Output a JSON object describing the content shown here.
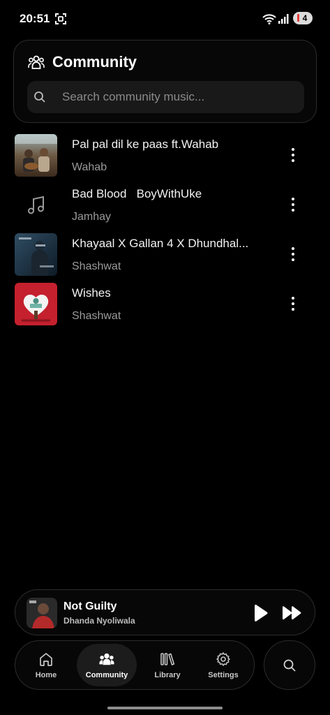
{
  "status_bar": {
    "time": "20:51",
    "battery": "4"
  },
  "header": {
    "title": "Community",
    "icon": "community-icon"
  },
  "search": {
    "placeholder": "Search community music..."
  },
  "songs": [
    {
      "title": "Pal pal dil ke paas ft.Wahab",
      "artist": "Wahab"
    },
    {
      "title": "Bad Blood   BoyWithUke",
      "artist": "Jamhay"
    },
    {
      "title": "Khayaal X Gallan 4 X Dhundhal...",
      "artist": "Shashwat"
    },
    {
      "title": "Wishes",
      "artist": "Shashwat"
    }
  ],
  "now_playing": {
    "title": "Not Guilty",
    "artist": "Dhanda Nyoliwala"
  },
  "nav": {
    "home": "Home",
    "community": "Community",
    "library": "Library",
    "settings": "Settings",
    "active": "community"
  },
  "colors": {
    "background": "#000000",
    "surface": "#070707",
    "border": "#2c2c2c",
    "text_secondary": "#9a9a9a"
  }
}
